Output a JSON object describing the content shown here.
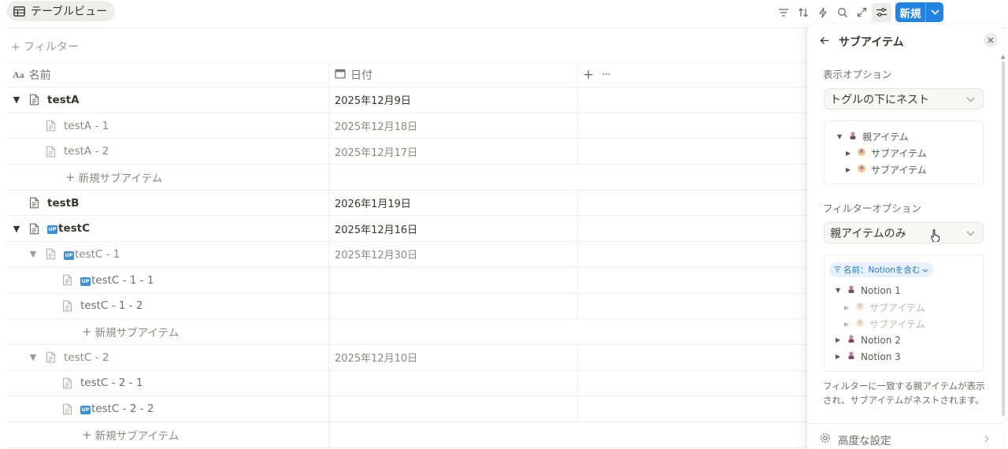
{
  "view_tab": {
    "icon": "table-icon",
    "label": "テーブルビュー"
  },
  "toolbar": {
    "icons": [
      "filter-icon",
      "sort-icon",
      "automation-icon",
      "search-icon",
      "expand-icon",
      "settings-icon"
    ],
    "new_label": "新規"
  },
  "filter_label": "+ フィルター",
  "table": {
    "columns": [
      {
        "icon": "text-property-icon",
        "label": "名前"
      },
      {
        "icon": "calendar-icon",
        "label": "日付"
      }
    ],
    "rows": [
      {
        "kind": "top",
        "toggle": "▼",
        "name": "testA",
        "badge": false,
        "date": "2025年12月9日",
        "indent": 0
      },
      {
        "kind": "sub",
        "toggle": "",
        "name": "testA - 1",
        "badge": false,
        "date": "2025年12月18日",
        "indent": 1
      },
      {
        "kind": "sub",
        "toggle": "",
        "name": "testA - 2",
        "badge": false,
        "date": "2025年12月17日",
        "indent": 1
      },
      {
        "kind": "add",
        "name": "新規サブアイテム",
        "indent": 1
      },
      {
        "kind": "top",
        "toggle": "",
        "name": "testB",
        "badge": false,
        "date": "2026年1月19日",
        "indent": 0
      },
      {
        "kind": "top",
        "toggle": "▼",
        "name": "testC",
        "badge": true,
        "date": "2025年12月16日",
        "indent": 0
      },
      {
        "kind": "sub",
        "toggle": "▼",
        "name": "testC - 1",
        "badge": true,
        "date": "2025年12月30日",
        "indent": 1
      },
      {
        "kind": "sub2",
        "toggle": "",
        "name": "testC - 1 - 1",
        "badge": true,
        "date": "",
        "indent": 2
      },
      {
        "kind": "sub2",
        "toggle": "",
        "name": "testC - 1 - 2",
        "badge": false,
        "date": "",
        "indent": 2
      },
      {
        "kind": "add",
        "name": "新規サブアイテム",
        "indent": 2
      },
      {
        "kind": "sub",
        "toggle": "▼",
        "name": "testC - 2",
        "badge": false,
        "date": "2025年12月10日",
        "indent": 1
      },
      {
        "kind": "sub2",
        "toggle": "",
        "name": "testC - 2 - 1",
        "badge": false,
        "date": "",
        "indent": 2
      },
      {
        "kind": "sub2",
        "toggle": "",
        "name": "testC - 2 - 2",
        "badge": true,
        "date": "",
        "indent": 2
      },
      {
        "kind": "add",
        "name": "新規サブアイテム",
        "indent": 2
      }
    ]
  },
  "panel": {
    "title": "サブアイテム",
    "display_label": "表示オプション",
    "display_value": "トグルの下にネスト",
    "display_preview": {
      "parent": "親アイテム",
      "children": [
        "サブアイテム",
        "サブアイテム"
      ]
    },
    "filter_label": "フィルターオプション",
    "filter_value": "親アイテムのみ",
    "filter_chip": "名前：Notionを含む",
    "filter_preview": {
      "items": [
        {
          "name": "Notion 1",
          "open": true,
          "children": [
            "サブアイテム",
            "サブアイテム"
          ]
        },
        {
          "name": "Notion 2",
          "open": false
        },
        {
          "name": "Notion 3",
          "open": false
        }
      ]
    },
    "description": "フィルターに一致する親アイテムが表示され、サブアイテムがネストされます。",
    "advanced_label": "高度な設定"
  },
  "colors": {
    "accent": "#2383e2",
    "badge": "#3d8fd6",
    "chip_bg": "#e7f1fb",
    "chip_text": "#2d7ac4"
  }
}
